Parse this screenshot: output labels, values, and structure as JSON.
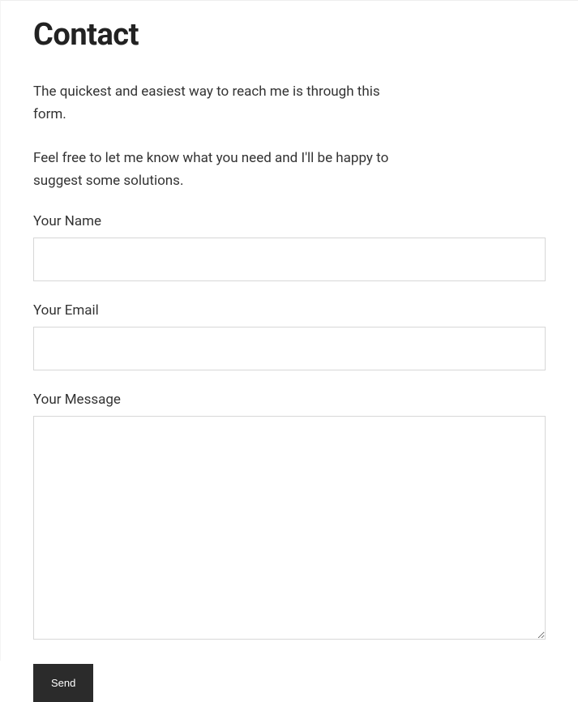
{
  "header": {
    "title": "Contact"
  },
  "intro": {
    "paragraph1": "The quickest and easiest way to reach me is through this form.",
    "paragraph2": "Feel free to let me know what you need and I'll be happy to suggest some solutions."
  },
  "form": {
    "fields": {
      "name": {
        "label": "Your Name",
        "value": ""
      },
      "email": {
        "label": "Your Email",
        "value": ""
      },
      "message": {
        "label": "Your Message",
        "value": ""
      }
    },
    "submit_label": "Send"
  }
}
